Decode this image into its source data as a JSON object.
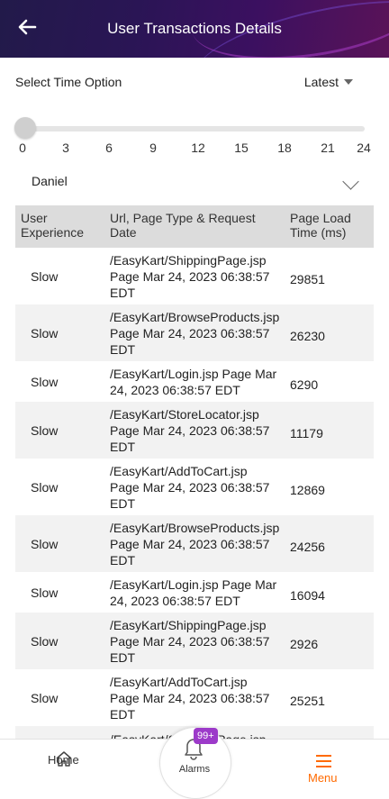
{
  "header": {
    "title": "User Transactions Details"
  },
  "filters": {
    "time_label": "Select Time Option",
    "time_value": "Latest",
    "slider_ticks": [
      "0",
      "3",
      "6",
      "9",
      "12",
      "15",
      "18",
      "21",
      "24"
    ],
    "slider_value": 0,
    "user_value": "Daniel"
  },
  "table": {
    "headers": [
      "User Experience",
      "Url, Page Type & Request Date",
      "Page Load Time (ms)"
    ],
    "rows": [
      {
        "exp": "Slow",
        "url": "/EasyKart/ShippingPage.jsp Page Mar 24, 2023 06:38:57 EDT",
        "time": "29851"
      },
      {
        "exp": "Slow",
        "url": "/EasyKart/BrowseProducts.jsp Page Mar 24, 2023 06:38:57 EDT",
        "time": "26230"
      },
      {
        "exp": "Slow",
        "url": "/EasyKart/Login.jsp Page Mar 24, 2023 06:38:57 EDT",
        "time": "6290"
      },
      {
        "exp": "Slow",
        "url": "/EasyKart/StoreLocator.jsp Page Mar 24, 2023 06:38:57 EDT",
        "time": "11179"
      },
      {
        "exp": "Slow",
        "url": "/EasyKart/AddToCart.jsp Page Mar 24, 2023 06:38:57 EDT",
        "time": "12869"
      },
      {
        "exp": "Slow",
        "url": "/EasyKart/BrowseProducts.jsp Page Mar 24, 2023 06:38:57 EDT",
        "time": "24256"
      },
      {
        "exp": "Slow",
        "url": "/EasyKart/Login.jsp Page Mar 24, 2023 06:38:57 EDT",
        "time": "16094"
      },
      {
        "exp": "Slow",
        "url": "/EasyKart/ShippingPage.jsp Page Mar 24, 2023 06:38:57 EDT",
        "time": "2926"
      },
      {
        "exp": "Slow",
        "url": "/EasyKart/AddToCart.jsp Page Mar 24, 2023 06:38:57 EDT",
        "time": "25251"
      },
      {
        "exp": "",
        "url": "/EasyKart/ShippingPage.jsp",
        "time": ""
      }
    ]
  },
  "nav": {
    "home_label": "Home",
    "alarms_label": "Alarms",
    "alarms_badge": "99+",
    "menu_label": "Menu"
  },
  "colors": {
    "accent": "#ff6a00",
    "badge": "#9c3ac9",
    "header_dark": "#221a4a"
  }
}
